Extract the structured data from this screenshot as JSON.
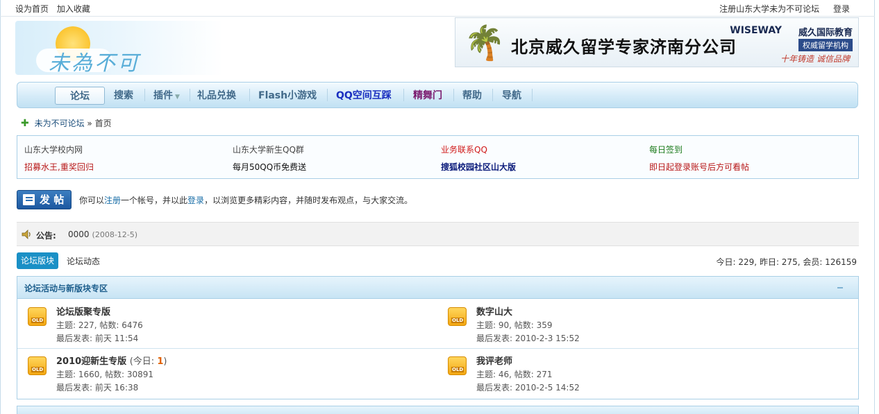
{
  "topbar": {
    "set_home": "设为首页",
    "add_fav": "加入收藏",
    "register": "注册山东大学未为不可论坛",
    "login": "登录"
  },
  "logo": {
    "text": "未為不可"
  },
  "banner": {
    "main": "北京威久留学专家济南分公司",
    "brand_mark": "WISEWAY",
    "brand_cn": "威久国际教育",
    "sub1": "权威留学机构",
    "sub2": "十年铸造 诚信品牌"
  },
  "nav": {
    "items": [
      "论坛",
      "搜索",
      "插件",
      "礼品兑换",
      "Flash小游戏",
      "QQ空间互踩",
      "精舞门",
      "帮助",
      "导航"
    ],
    "colors": {
      "qq": "#1a2fc0",
      "jingwu": "#7a1a6e",
      "default": "#426a8a"
    }
  },
  "breadcrumb": {
    "forum": "未为不可论坛",
    "sep": "»",
    "home": "首页"
  },
  "links": {
    "row1": [
      "山东大学校内网",
      "山东大学新生QQ群",
      "业务联系QQ",
      "每日签到"
    ],
    "row2": [
      "招募水王,重奖回归",
      "每月50QQ币免费送",
      "搜狐校园社区山大版",
      "即日起登录账号后方可看帖"
    ]
  },
  "post": {
    "button": "发 帖",
    "tip_prefix": "你可以",
    "tip_register": "注册",
    "tip_mid": "一个帐号，并以此",
    "tip_login": "登录",
    "tip_suffix": "，以浏览更多精彩内容，并随时发布观点，与大家交流。"
  },
  "notice": {
    "label": "公告:",
    "text": "0000",
    "date": "(2008-12-5)"
  },
  "tabs": {
    "active": "论坛版块",
    "other": "论坛动态"
  },
  "stats": "今日: 229, 昨日: 275, 会员: 126159",
  "board": {
    "title": "论坛活动与新版块专区",
    "icon_label": "OLD",
    "forums": [
      {
        "name": "论坛版聚专版",
        "stats": "主题: 227, 帖数: 6476",
        "last": "最后发表: 前天 11:54"
      },
      {
        "name": "数字山大",
        "stats": "主题: 90, 帖数: 359",
        "last": "最后发表: 2010-2-3 15:52"
      },
      {
        "name": "2010迎新生专版",
        "today_prefix": "(今日: ",
        "today_num": "1",
        "today_suffix": ")",
        "stats": "主题: 1660, 帖数: 30891",
        "last": "最后发表: 前天 16:38"
      },
      {
        "name": "我评老师",
        "stats": "主题: 46, 帖数: 271",
        "last": "最后发表: 2010-2-5 14:52"
      }
    ]
  }
}
